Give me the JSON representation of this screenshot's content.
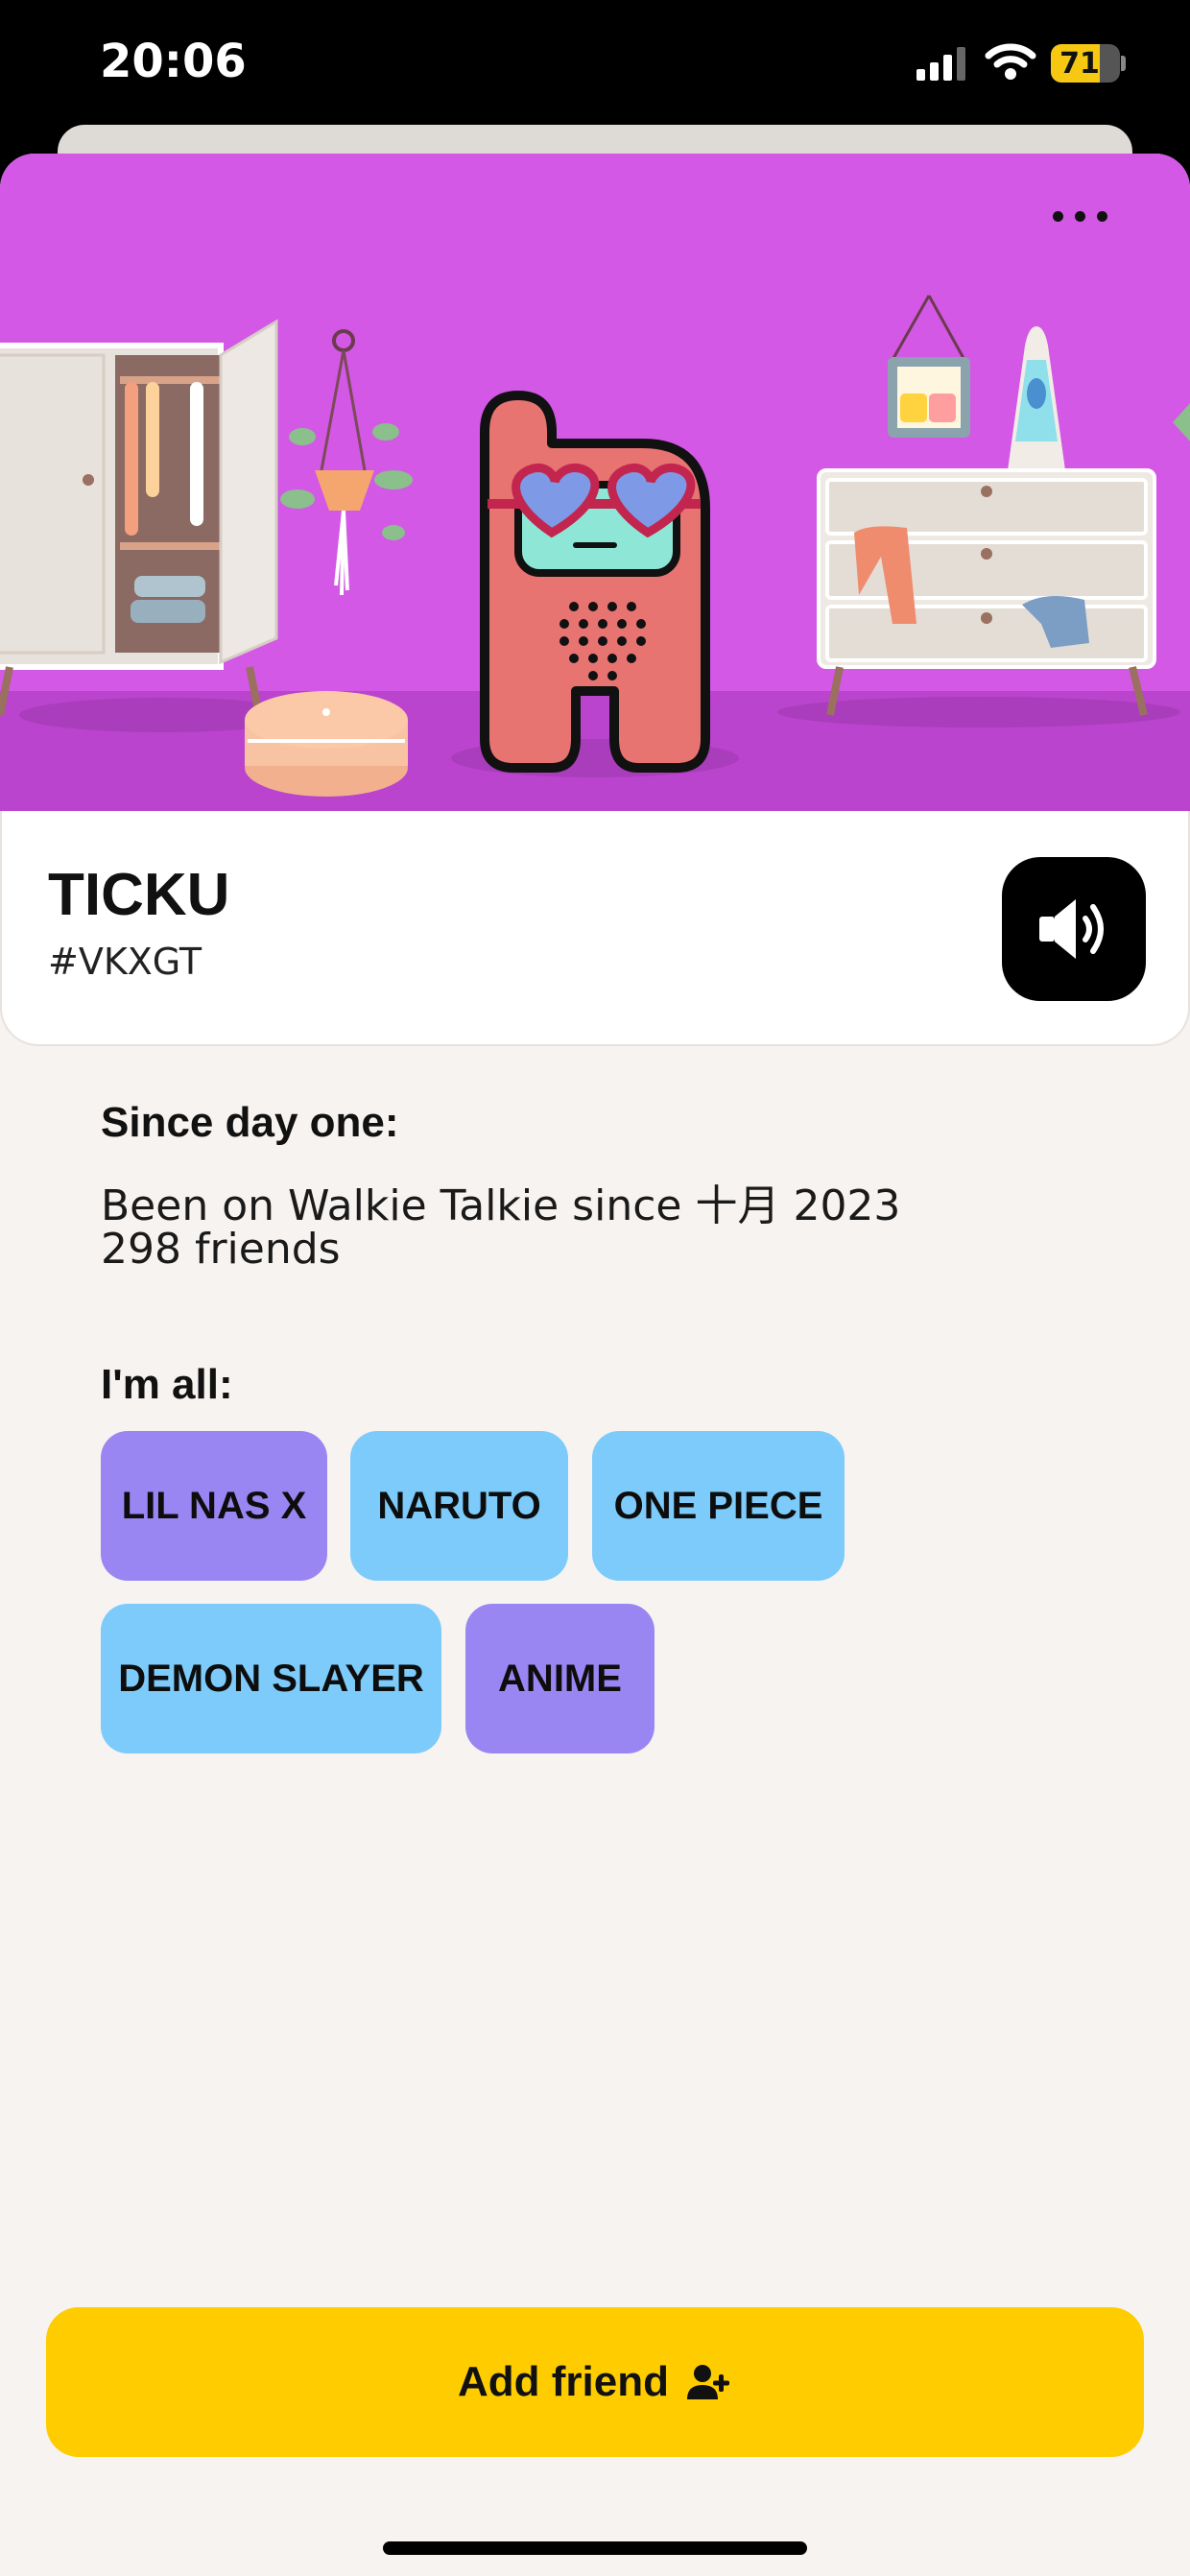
{
  "status_bar": {
    "time": "20:06",
    "battery": "71",
    "battery_level": 0.71
  },
  "profile": {
    "name": "TICKU",
    "code": "#VKXGT"
  },
  "since": {
    "heading": "Since day one:",
    "joined": "Been on Walkie Talkie since 十月 2023",
    "friends": "298 friends"
  },
  "interests": {
    "heading": "I'm all:",
    "tags": [
      {
        "label": "LIL NAS X",
        "color": "#9a86f2"
      },
      {
        "label": "NARUTO",
        "color": "#7dcbfb"
      },
      {
        "label": "ONE PIECE",
        "color": "#7dcbfb"
      },
      {
        "label": "DEMON SLAYER",
        "color": "#7dcbfb"
      },
      {
        "label": "ANIME",
        "color": "#9a86f2"
      }
    ]
  },
  "actions": {
    "add_friend": "Add friend"
  },
  "icons": {
    "more": "more-dots-icon",
    "sound": "speaker-icon",
    "add_friend": "user-plus-icon"
  },
  "colors": {
    "hero_bg": "#d358e6",
    "accent": "#ffcc00",
    "page_bg": "#f7f3f0"
  }
}
